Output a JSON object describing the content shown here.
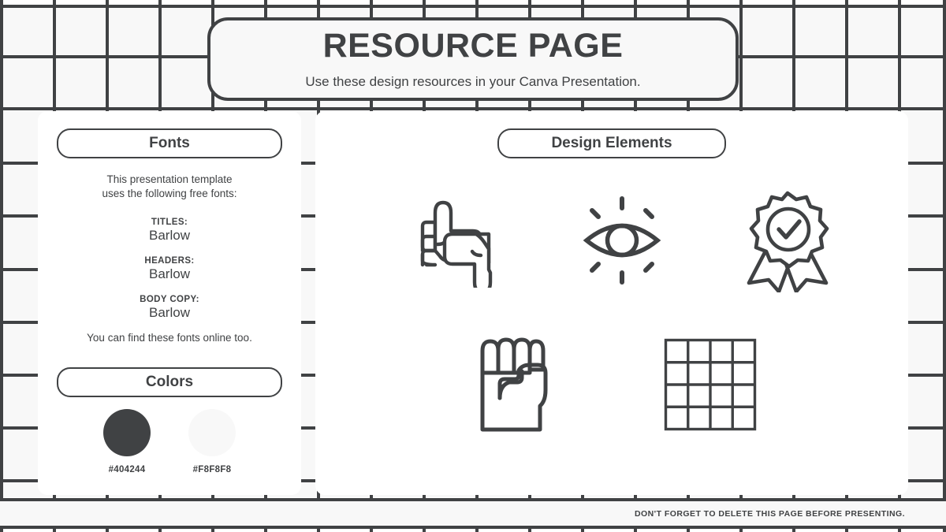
{
  "header": {
    "title": "RESOURCE PAGE",
    "subtitle": "Use these design resources in your Canva Presentation."
  },
  "fonts_panel": {
    "section_title": "Fonts",
    "intro_line_1": "This presentation template",
    "intro_line_2": "uses the following free fonts:",
    "entries": [
      {
        "role": "TITLES:",
        "name": "Barlow"
      },
      {
        "role": "HEADERS:",
        "name": "Barlow"
      },
      {
        "role": "BODY COPY:",
        "name": "Barlow"
      }
    ],
    "outro": "You can find these fonts online too."
  },
  "colors_panel": {
    "section_title": "Colors",
    "swatches": [
      {
        "label": "#404244",
        "hex": "#404244"
      },
      {
        "label": "#F8F8F8",
        "hex": "#F8F8F8"
      }
    ]
  },
  "design_panel": {
    "section_title": "Design Elements",
    "elements": [
      {
        "icon": "thumbs-up-down-icon",
        "name": "thumbs-up-down"
      },
      {
        "icon": "eye-rays-icon",
        "name": "eye-with-rays"
      },
      {
        "icon": "award-badge-check-icon",
        "name": "award-badge-check"
      },
      {
        "icon": "raised-fist-icon",
        "name": "raised-fist"
      },
      {
        "icon": "grid-4x4-icon",
        "name": "grid-4x4"
      }
    ]
  },
  "footer": {
    "note": "DON'T FORGET TO DELETE THIS PAGE BEFORE PRESENTING."
  },
  "theme": {
    "ink": "#404244",
    "paper": "#F8F8F8",
    "panel": "#FFFFFF"
  }
}
